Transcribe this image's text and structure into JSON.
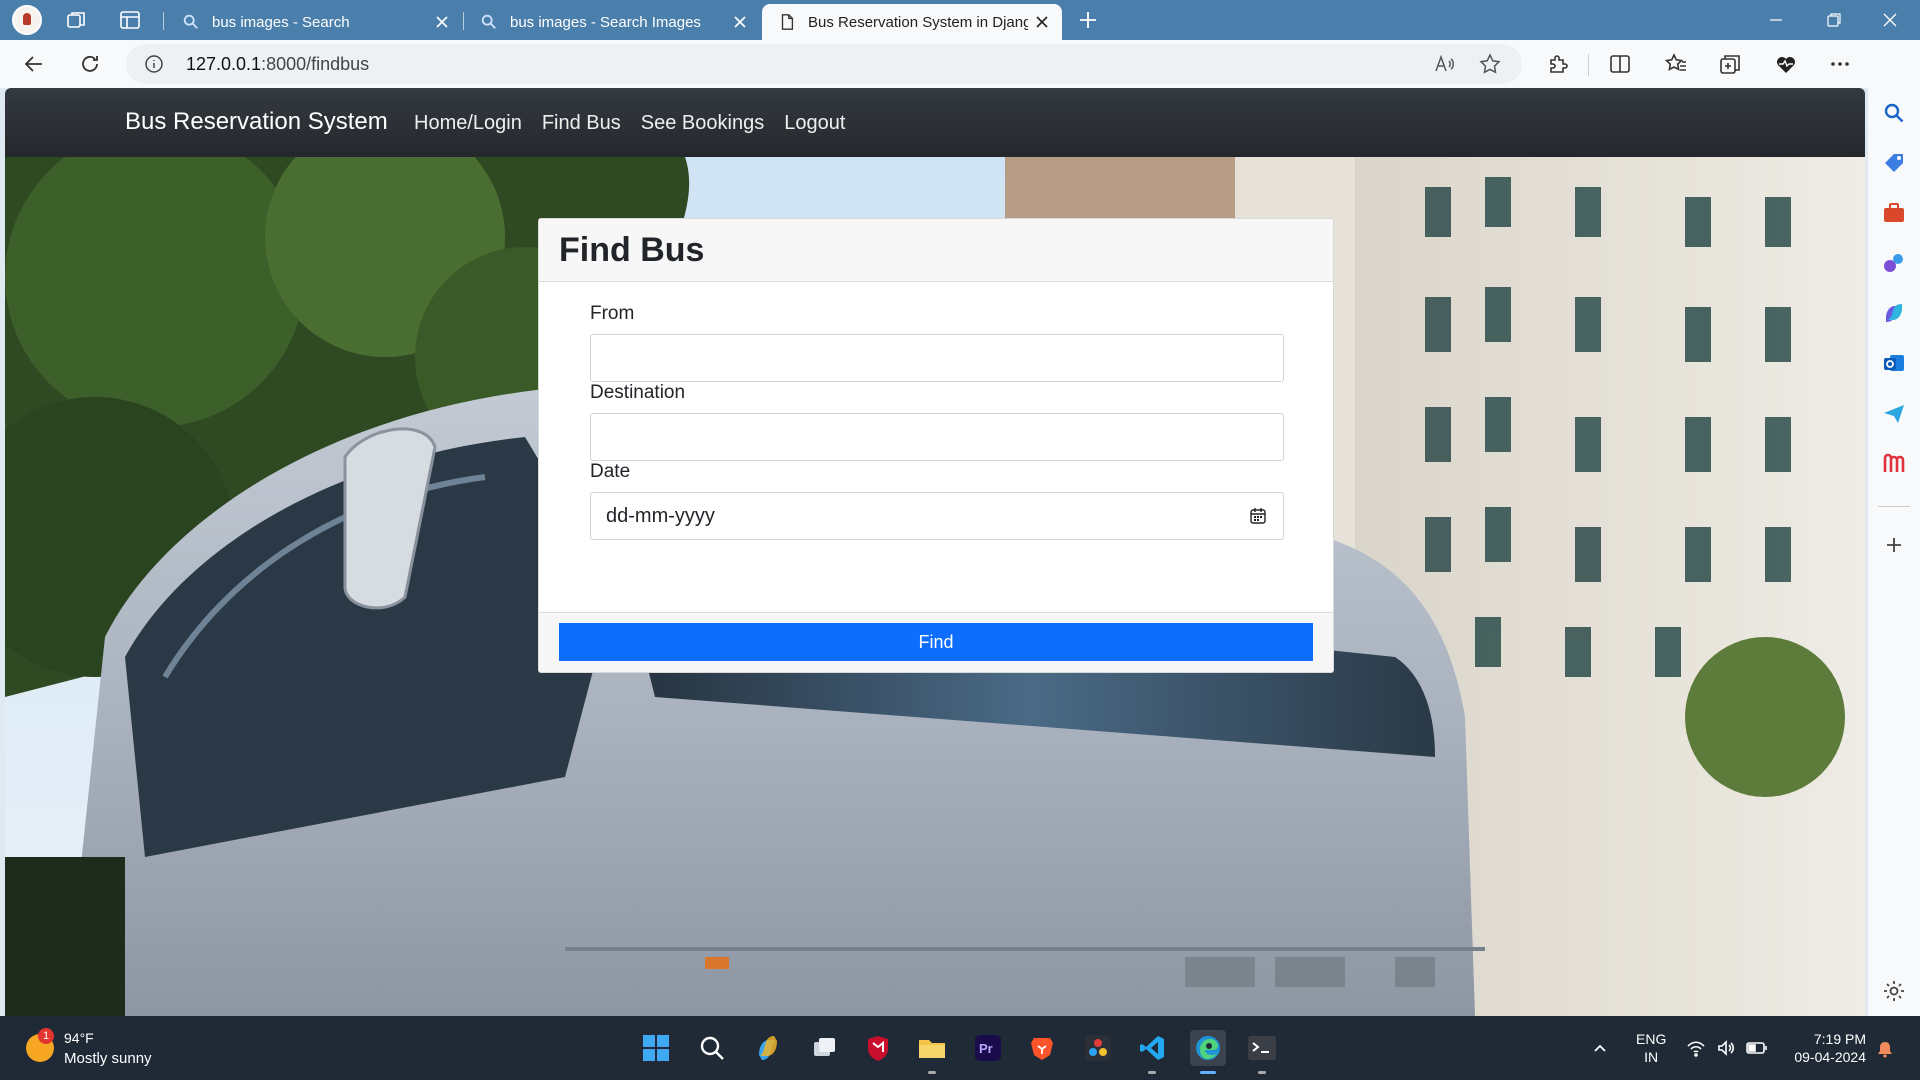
{
  "browser": {
    "tabs": [
      {
        "title": "bus images - Search"
      },
      {
        "title": "bus images - Search Images"
      },
      {
        "title": "Bus Reservation System in Djang"
      }
    ],
    "url_host": "127.0.0.1",
    "url_rest": ":8000/findbus"
  },
  "navbar": {
    "brand": "Bus Reservation System",
    "links": [
      "Home/Login",
      "Find Bus",
      "See Bookings",
      "Logout"
    ]
  },
  "form": {
    "title": "Find Bus",
    "from_label": "From",
    "from_value": "",
    "destination_label": "Destination",
    "destination_value": "",
    "date_label": "Date",
    "date_placeholder": "dd-mm-yyyy",
    "submit_label": "Find"
  },
  "taskbar": {
    "weather_badge": "1",
    "weather_temp": "94°F",
    "weather_condition": "Mostly sunny",
    "lang_line1": "ENG",
    "lang_line2": "IN",
    "time": "7:19 PM",
    "date": "09-04-2024"
  },
  "colors": {
    "navbar": "#343a40",
    "primary_button": "#0d6efd",
    "tabstrip": "#4b7fab",
    "taskbar": "#1f2a36"
  }
}
